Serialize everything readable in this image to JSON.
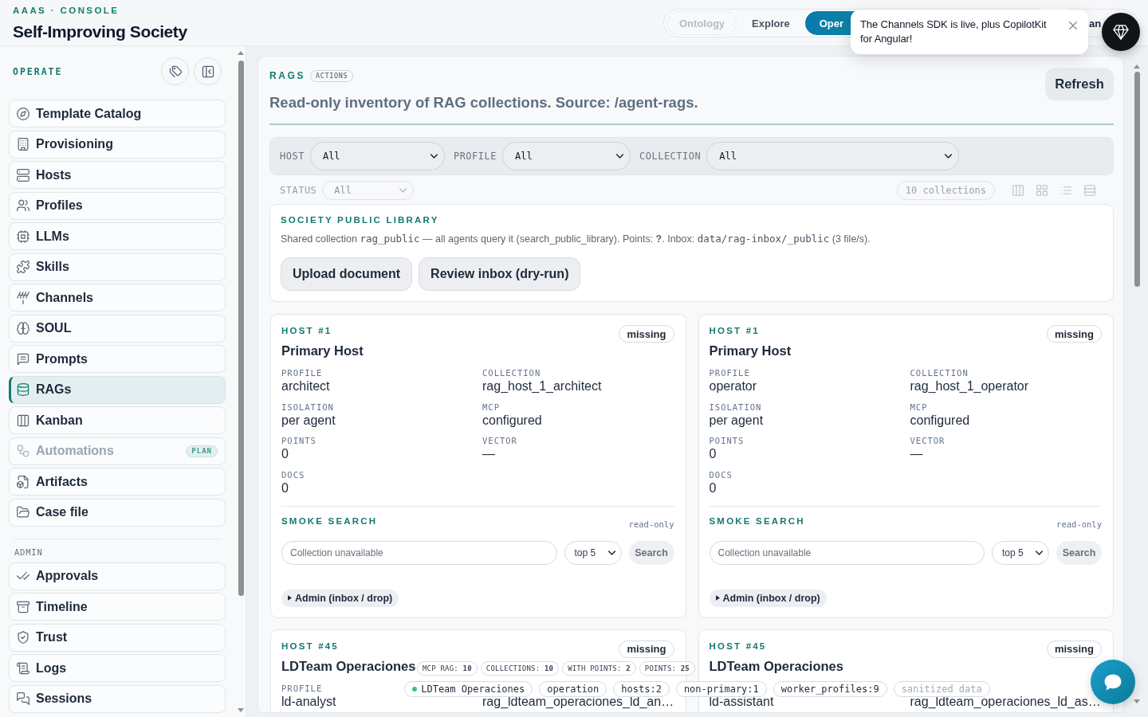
{
  "header": {
    "eyebrow": "AAAS · CONSOLE",
    "title": "Self-Improving Society"
  },
  "nav_tabs": [
    {
      "label": "Ontology",
      "selected": false,
      "disabled": true
    },
    {
      "label": "Explore",
      "selected": false,
      "disabled": false
    },
    {
      "label": "Oper",
      "selected": true,
      "disabled": false
    }
  ],
  "header_button": {
    "label": "an"
  },
  "toast": {
    "text": "The Channels SDK is live, plus CopilotKit for Angular!"
  },
  "sidebar": {
    "sections": [
      {
        "kind": "main",
        "label": "OPERATE",
        "items": [
          {
            "label": "Template Catalog",
            "selected": false,
            "disabled": false
          },
          {
            "label": "Provisioning",
            "selected": false,
            "disabled": false
          },
          {
            "label": "Hosts",
            "selected": false,
            "disabled": false
          },
          {
            "label": "Profiles",
            "selected": false,
            "disabled": false
          },
          {
            "label": "LLMs",
            "selected": false,
            "disabled": false
          },
          {
            "label": "Skills",
            "selected": false,
            "disabled": false
          },
          {
            "label": "Channels",
            "selected": false,
            "disabled": false
          },
          {
            "label": "SOUL",
            "selected": false,
            "disabled": false
          },
          {
            "label": "Prompts",
            "selected": false,
            "disabled": false
          },
          {
            "label": "RAGs",
            "selected": true,
            "disabled": false
          },
          {
            "label": "Kanban",
            "selected": false,
            "disabled": false
          },
          {
            "label": "Automations",
            "selected": false,
            "disabled": true,
            "badge": "PLAN"
          },
          {
            "label": "Artifacts",
            "selected": false,
            "disabled": false
          },
          {
            "label": "Case file",
            "selected": false,
            "disabled": false
          }
        ]
      },
      {
        "kind": "group",
        "label": "ADMIN",
        "items": [
          {
            "label": "Approvals",
            "selected": false,
            "disabled": false
          },
          {
            "label": "Timeline",
            "selected": false,
            "disabled": false
          },
          {
            "label": "Trust",
            "selected": false,
            "disabled": false
          },
          {
            "label": "Logs",
            "selected": false,
            "disabled": false
          },
          {
            "label": "Sessions",
            "selected": false,
            "disabled": false
          }
        ]
      }
    ]
  },
  "page": {
    "eyebrow": "RAGS",
    "tag": "ACTIONS",
    "subtitle": "Read-only inventory of RAG collections. Source: /agent-rags.",
    "refresh_button": "Refresh"
  },
  "filters": [
    {
      "label": "HOST",
      "value": "All"
    },
    {
      "label": "PROFILE",
      "value": "All"
    },
    {
      "label": "COLLECTION",
      "value": "All"
    }
  ],
  "status_row": {
    "label": "STATUS",
    "value": "All",
    "count": "10 collections"
  },
  "public_library": {
    "title": "SOCIETY PUBLIC LIBRARY",
    "description": [
      {
        "kind": "text",
        "text": "Shared collection "
      },
      {
        "kind": "code",
        "text": "rag_public"
      },
      {
        "kind": "text",
        "text": " — all agents query it (search_public_library). Points: **?**. Inbox: "
      },
      {
        "kind": "code",
        "text": "data/rag-inbox/_public"
      },
      {
        "kind": "text",
        "text": " (3 file/s)."
      }
    ],
    "buttons": [
      "Upload document",
      "Review inbox (dry-run)"
    ]
  },
  "hosts": [
    {
      "host_label": "HOST #1",
      "status": "missing",
      "name": "Primary Host",
      "fields": [
        {
          "label": "PROFILE",
          "value": "architect"
        },
        {
          "label": "COLLECTION",
          "value": "rag_host_1_architect"
        },
        {
          "label": "ISOLATION",
          "value": "per agent"
        },
        {
          "label": "MCP",
          "value": "configured"
        },
        {
          "label": "POINTS",
          "value": "0"
        },
        {
          "label": "VECTOR",
          "value": "—"
        },
        {
          "label": "DOCS",
          "value": "0"
        }
      ],
      "smoke_search": {
        "title": "SMOKE SEARCH",
        "mode": "read-only",
        "placeholder": "Collection unavailable",
        "limit": "top 5",
        "button": "Search"
      },
      "admin": {
        "label": "Admin (inbox / drop)",
        "expanded": false
      }
    },
    {
      "host_label": "HOST #1",
      "status": "missing",
      "name": "Primary Host",
      "fields": [
        {
          "label": "PROFILE",
          "value": "operator"
        },
        {
          "label": "COLLECTION",
          "value": "rag_host_1_operator"
        },
        {
          "label": "ISOLATION",
          "value": "per agent"
        },
        {
          "label": "MCP",
          "value": "configured"
        },
        {
          "label": "POINTS",
          "value": "0"
        },
        {
          "label": "VECTOR",
          "value": "—"
        },
        {
          "label": "DOCS",
          "value": "0"
        }
      ],
      "smoke_search": {
        "title": "SMOKE SEARCH",
        "mode": "read-only",
        "placeholder": "Collection unavailable",
        "limit": "top 5",
        "button": "Search"
      },
      "admin": {
        "label": "Admin (inbox / drop)",
        "expanded": false
      }
    },
    {
      "host_label": "HOST #45",
      "status": "missing",
      "name": "LDTeam Operaciones",
      "fields": [
        {
          "label": "PROFILE",
          "value": "ld-analyst"
        },
        {
          "value": "rag_ldteam_operaciones_ld_an…"
        }
      ]
    },
    {
      "host_label": "HOST #45",
      "status": "missing",
      "name": "LDTeam Operaciones",
      "fields": [
        {
          "value": "ld-assistant"
        },
        {
          "value": "rag_ldteam_operaciones_ld_as…"
        }
      ]
    }
  ],
  "summary_bar": {
    "stats": [
      "MCP RAG: **10**",
      "COLLECTIONS: **10**",
      "WITH POINTS: **2**",
      "POINTS: **25**"
    ],
    "tags": [
      {
        "kind": "host",
        "text": "LDTeam Operaciones"
      },
      {
        "kind": "plain",
        "text": "operation"
      },
      {
        "kind": "plain",
        "text": "hosts:2"
      },
      {
        "kind": "plain",
        "text": "non-primary:1"
      },
      {
        "kind": "plain",
        "text": "worker_profiles:9"
      },
      {
        "kind": "muted",
        "text": "sanitized data"
      }
    ]
  }
}
